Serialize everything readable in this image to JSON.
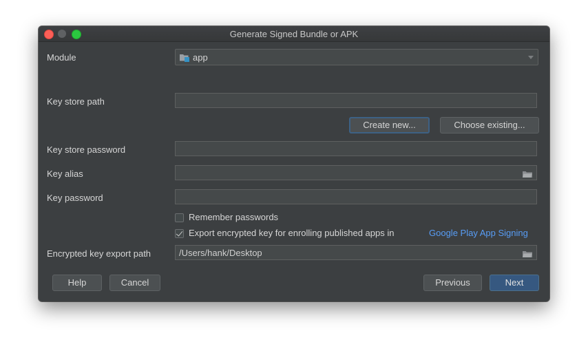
{
  "window": {
    "title": "Generate Signed Bundle or APK"
  },
  "module": {
    "label": "Module",
    "value": "app",
    "icon": "android-module-icon"
  },
  "key_store_path": {
    "label": "Key store path",
    "value": "",
    "create_new_label": "Create new...",
    "choose_existing_label": "Choose existing..."
  },
  "key_store_password": {
    "label": "Key store password",
    "value": ""
  },
  "key_alias": {
    "label": "Key alias",
    "value": "",
    "icon": "folder-icon"
  },
  "key_password": {
    "label": "Key password",
    "value": ""
  },
  "remember_passwords": {
    "label": "Remember passwords",
    "checked": false
  },
  "export_encrypted": {
    "label": "Export encrypted key for enrolling published apps in",
    "link": "Google Play App Signing",
    "checked": true
  },
  "encrypted_export_path": {
    "label": "Encrypted key export path",
    "value": "/Users/hank/Desktop",
    "icon": "folder-icon"
  },
  "footer": {
    "help_label": "Help",
    "cancel_label": "Cancel",
    "previous_label": "Previous",
    "next_label": "Next"
  },
  "colors": {
    "window_bg": "#3c3f41",
    "accent": "#365880",
    "link": "#589df6"
  }
}
